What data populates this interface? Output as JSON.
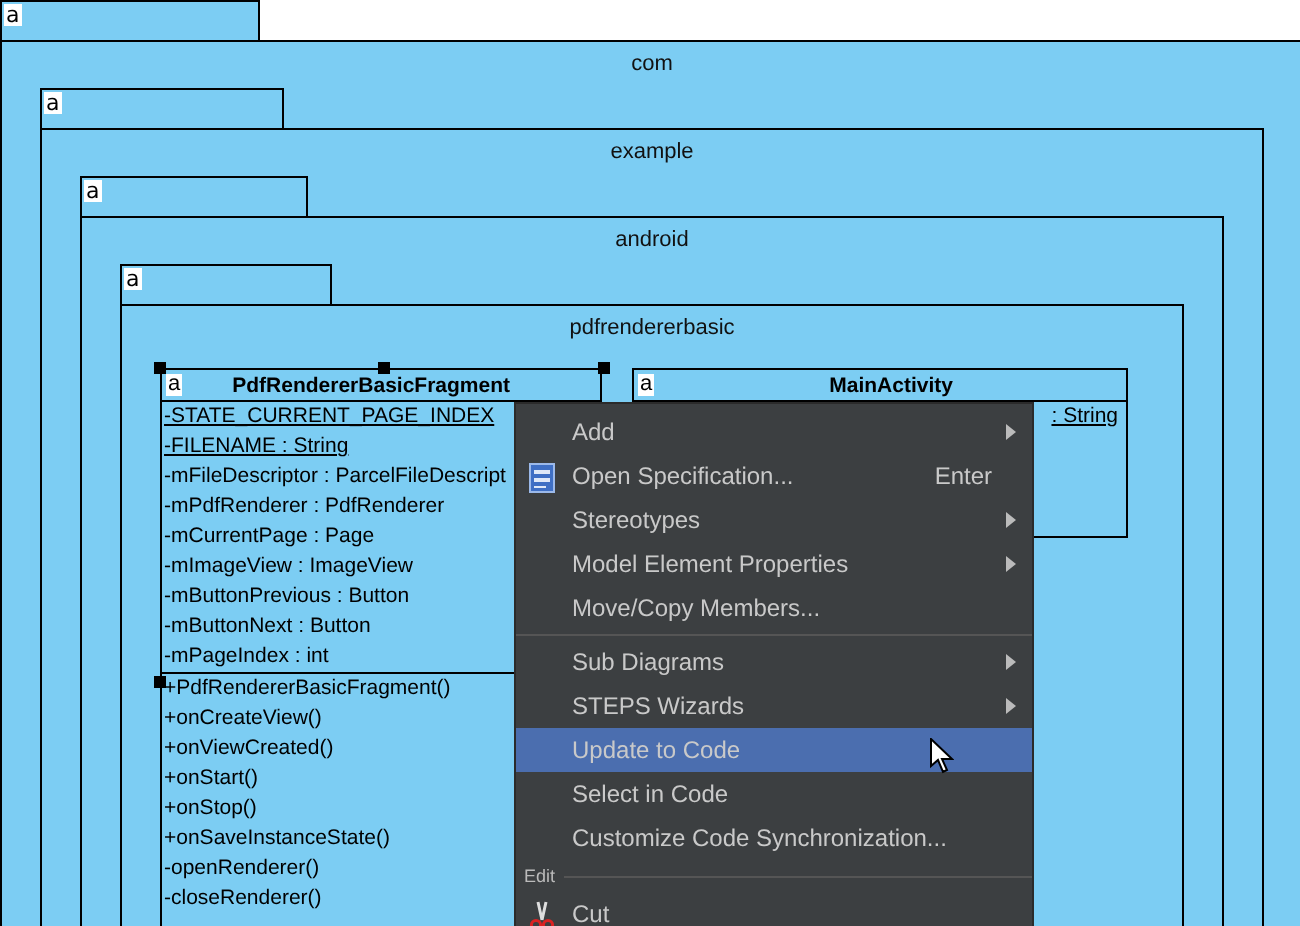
{
  "package": {
    "tab_label": "a",
    "name": "com",
    "children": {
      "tab_label": "a",
      "name": "example",
      "children": {
        "tab_label": "a",
        "name": "android",
        "children": {
          "tab_label": "a",
          "name": "pdfrendererbasic",
          "classes": [
            {
              "tab_label": "a",
              "name": "PdfRendererBasicFragment",
              "selected": true,
              "attributes": [
                {
                  "text": "-STATE_CURRENT_PAGE_INDEX",
                  "static": true
                },
                {
                  "text": "-FILENAME : String",
                  "static": true
                },
                {
                  "text": "-mFileDescriptor : ParcelFileDescript",
                  "static": false
                },
                {
                  "text": "-mPdfRenderer : PdfRenderer",
                  "static": false
                },
                {
                  "text": "-mCurrentPage : Page",
                  "static": false
                },
                {
                  "text": "-mImageView : ImageView",
                  "static": false
                },
                {
                  "text": "-mButtonPrevious : Button",
                  "static": false
                },
                {
                  "text": "-mButtonNext : Button",
                  "static": false
                },
                {
                  "text": "-mPageIndex : int",
                  "static": false
                }
              ],
              "operations": [
                "+PdfRendererBasicFragment()",
                "+onCreateView()",
                "+onViewCreated()",
                "+onStart()",
                "+onStop()",
                "+onSaveInstanceState()",
                "-openRenderer()",
                "-closeRenderer()"
              ]
            },
            {
              "tab_label": "a",
              "name": "MainActivity",
              "selected": false,
              "attributes": [
                {
                  "text": ": String",
                  "static": true
                }
              ]
            }
          ]
        }
      }
    }
  },
  "context_menu": {
    "items": [
      {
        "kind": "item",
        "label": "Add",
        "submenu": true,
        "selected": false
      },
      {
        "kind": "document",
        "label": "Open Specification...",
        "shortcut": "Enter",
        "submenu": false,
        "selected": false
      },
      {
        "kind": "item",
        "label": "Stereotypes",
        "submenu": true,
        "selected": false
      },
      {
        "kind": "item",
        "label": "Model Element Properties",
        "submenu": true,
        "selected": false
      },
      {
        "kind": "item",
        "label": "Move/Copy Members...",
        "submenu": false,
        "selected": false
      },
      {
        "kind": "separator"
      },
      {
        "kind": "item",
        "label": "Sub Diagrams",
        "submenu": true,
        "selected": false
      },
      {
        "kind": "item",
        "label": "STEPS Wizards",
        "submenu": true,
        "selected": false
      },
      {
        "kind": "item",
        "label": "Update to Code",
        "submenu": false,
        "selected": true
      },
      {
        "kind": "item",
        "label": "Select in Code",
        "submenu": false,
        "selected": false
      },
      {
        "kind": "item",
        "label": "Customize Code Synchronization...",
        "submenu": false,
        "selected": false
      },
      {
        "kind": "heading",
        "label": "Edit"
      },
      {
        "kind": "scissors",
        "label": "Cut",
        "submenu": false,
        "selected": false
      }
    ]
  }
}
